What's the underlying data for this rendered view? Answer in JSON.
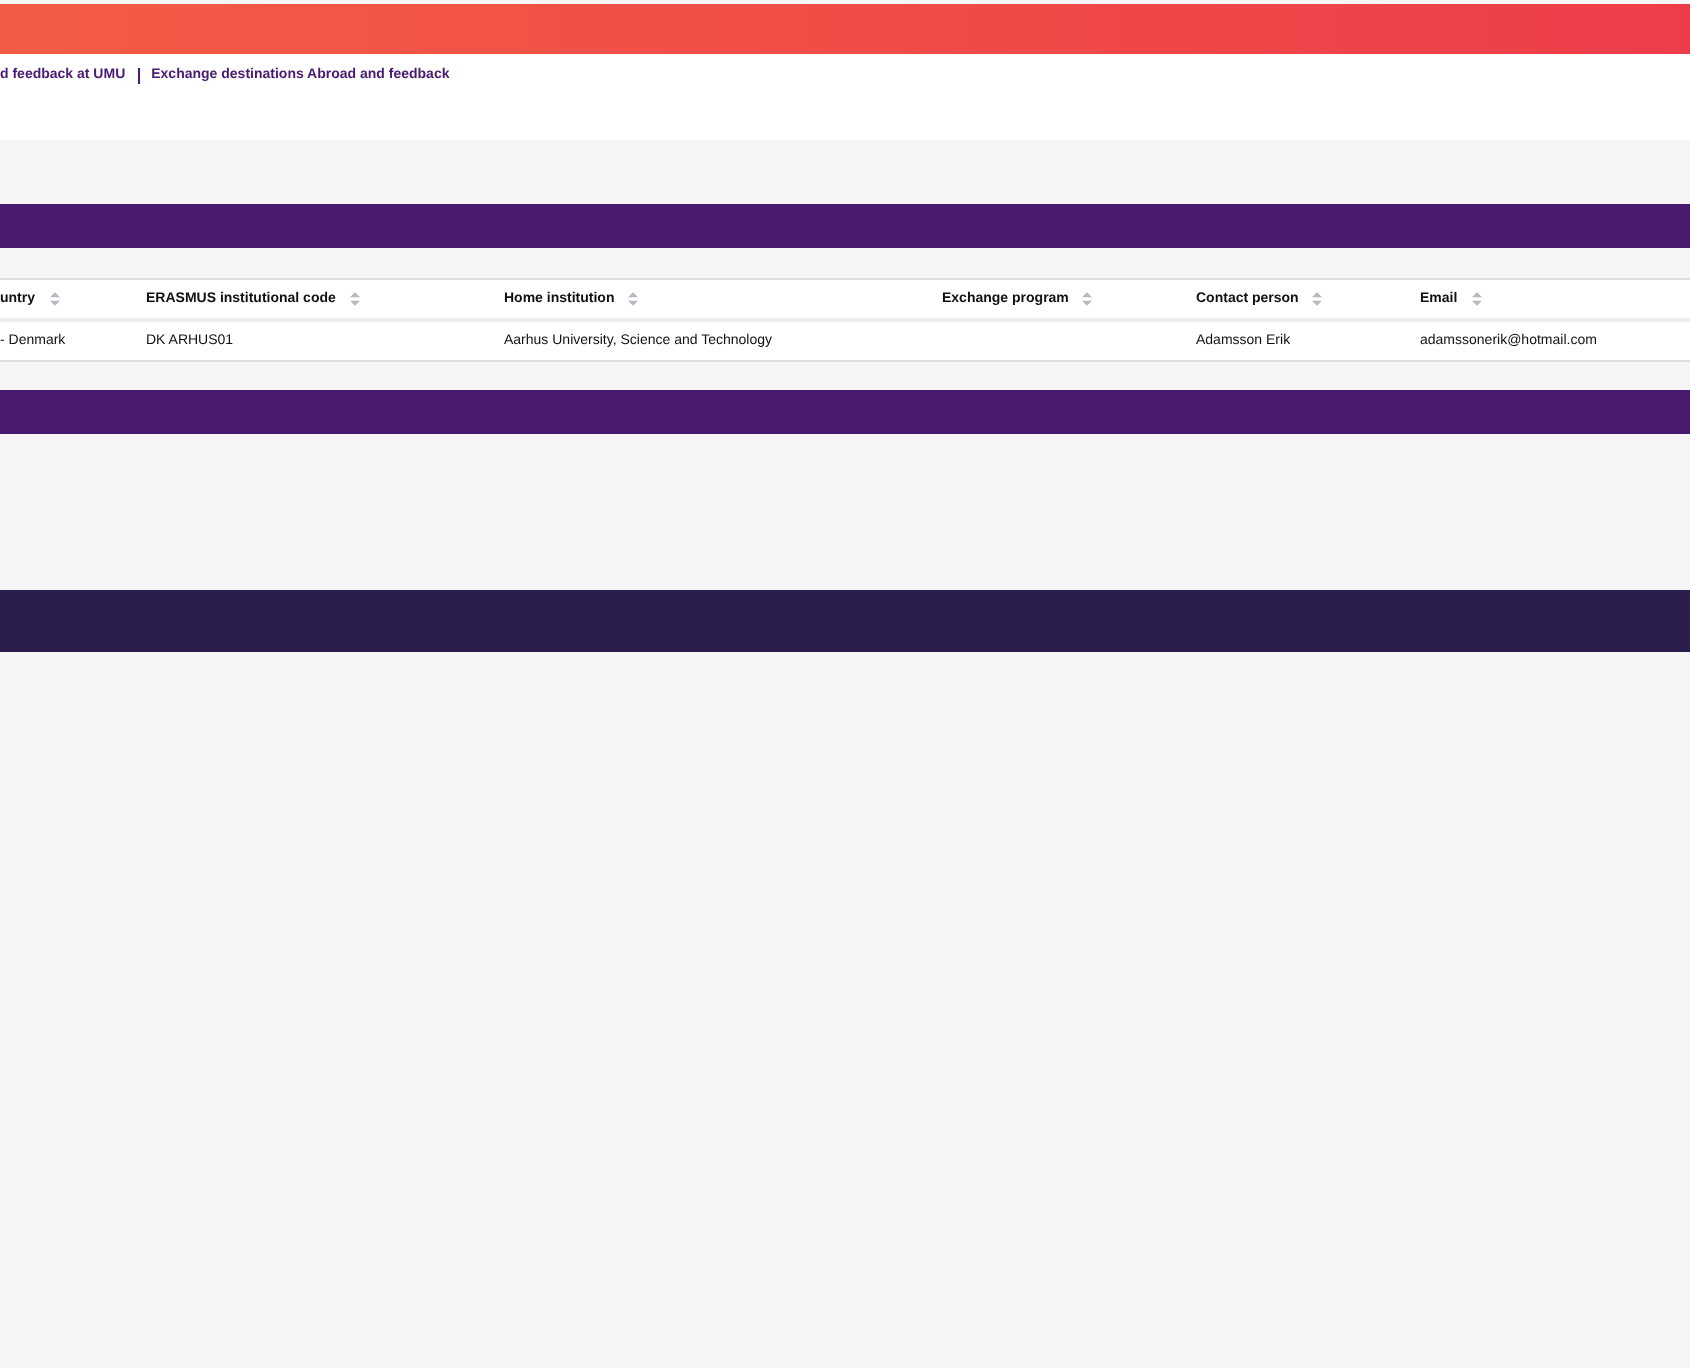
{
  "breadcrumb": [
    {
      "label": "d feedback at UMU"
    },
    {
      "label": "Exchange destinations Abroad and feedback"
    }
  ],
  "table": {
    "columns": [
      {
        "label": "untry",
        "sortable": true
      },
      {
        "label": "ERASMUS institutional code",
        "sortable": true
      },
      {
        "label": "Home institution",
        "sortable": true
      },
      {
        "label": "Exchange program",
        "sortable": true
      },
      {
        "label": "Contact person",
        "sortable": true
      },
      {
        "label": "Email",
        "sortable": true
      }
    ],
    "rows": [
      [
        "- Denmark",
        "DK ARHUS01",
        "Aarhus University, Science and Technology",
        "",
        "Adamsson Erik",
        "adamssonerik@hotmail.com"
      ]
    ]
  }
}
